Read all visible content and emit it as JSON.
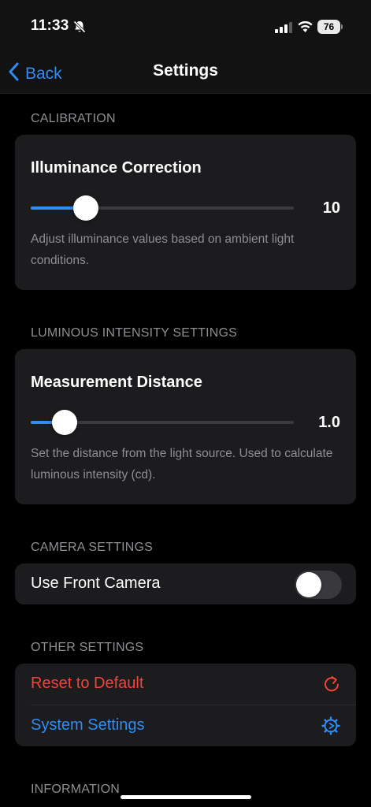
{
  "status_bar": {
    "time": "11:33",
    "battery": "76",
    "icons": [
      "bell-slash-icon",
      "signal-icon",
      "wifi-icon",
      "battery-icon"
    ]
  },
  "nav": {
    "back_label": "Back",
    "title": "Settings"
  },
  "calibration": {
    "header": "CALIBRATION",
    "title": "Illuminance Correction",
    "value": "10",
    "slider_fraction": 0.21,
    "description": "Adjust illuminance values based on ambient light conditions."
  },
  "luminous": {
    "header": "LUMINOUS INTENSITY SETTINGS",
    "title": "Measurement Distance",
    "value": "1.0",
    "slider_fraction": 0.13,
    "description": "Set the distance from the light source. Used to calculate luminous intensity (cd)."
  },
  "camera": {
    "header": "CAMERA SETTINGS",
    "front_camera_label": "Use Front Camera",
    "front_camera_on": false
  },
  "other": {
    "header": "OTHER SETTINGS",
    "reset_label": "Reset to Default",
    "system_label": "System Settings"
  },
  "information": {
    "header": "INFORMATION"
  },
  "colors": {
    "accent": "#2f8cf3",
    "destructive": "#f0443a",
    "background": "#000000",
    "card": "#1c1c1e",
    "secondary_text": "#8e8e93"
  }
}
